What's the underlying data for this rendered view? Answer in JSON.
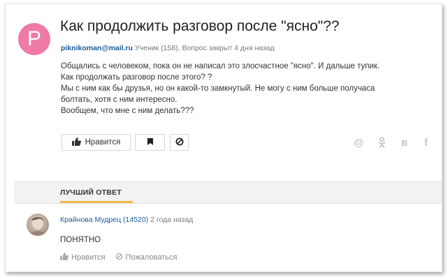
{
  "question": {
    "avatar_letter": "P",
    "avatar_color": "#ef7aa6",
    "title": "Как продолжить разговор после \"ясно\"??",
    "author": "piknikoman@mail.ru",
    "status": "Ученик (158), Вопрос закрыт 4 дня назад",
    "body_lines": [
      "Общались с человеком, пока он не написал это злосчастное \"ясно\". И дальше тупик.",
      "Как продолжать разговор после этого? ?",
      "Мы с ним как бы друзья, но он какой-то замкнутый. Не могу с ним больше получаса",
      "болтать, хотя с ним интересно.",
      "Вообщем, что мне с ним делать???"
    ],
    "like_label": "Нравится",
    "share_icons": [
      "at-icon",
      "odnoklassniki-icon",
      "vk-icon",
      "facebook-icon"
    ]
  },
  "best_answer": {
    "section_label": "ЛУЧШИЙ ОТВЕТ",
    "accent_color": "#f2b94b",
    "author": "Крайнова",
    "rank": "Мудрец (14520)",
    "time": "2 года назад",
    "text": "ПОНЯТНО",
    "like_label": "Нравится",
    "report_label": "Пожаловаться"
  }
}
